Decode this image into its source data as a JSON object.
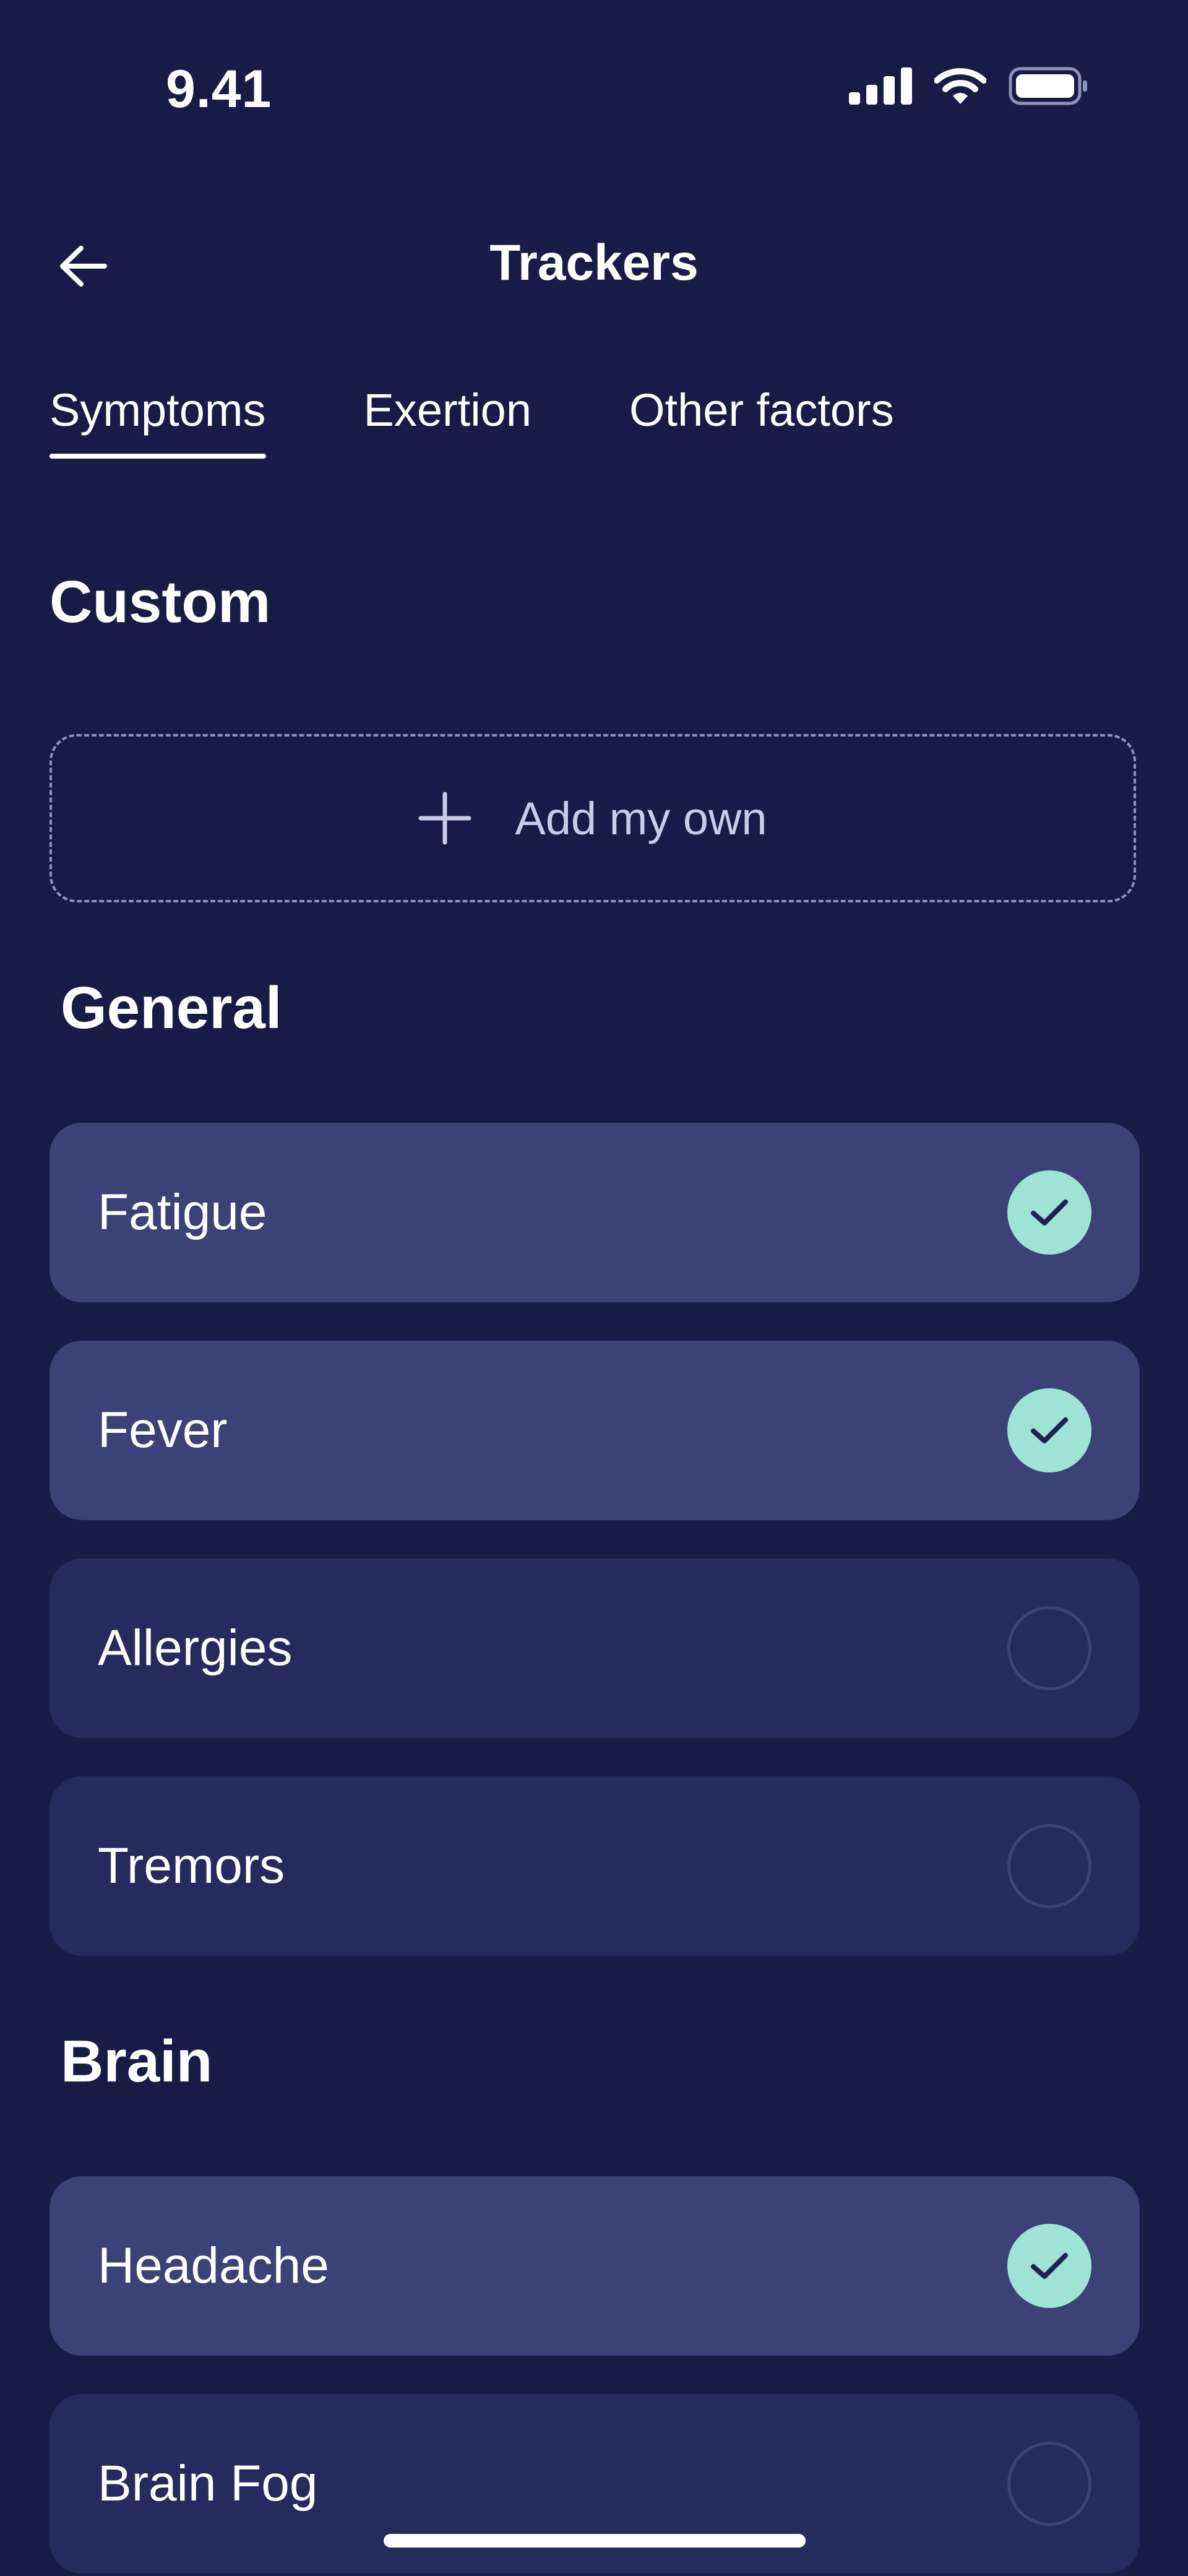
{
  "status_bar": {
    "time": "9.41",
    "icons": [
      "signal-icon",
      "wifi-icon",
      "battery-icon"
    ]
  },
  "header": {
    "title": "Trackers",
    "back_icon": "arrow-left-icon"
  },
  "tabs": [
    {
      "label": "Symptoms",
      "active": true
    },
    {
      "label": "Exertion",
      "active": false
    },
    {
      "label": "Other factors",
      "active": false
    }
  ],
  "custom": {
    "title": "Custom",
    "add_label": "Add my own",
    "add_icon": "plus-icon"
  },
  "general": {
    "title": "General",
    "items": [
      {
        "label": "Fatigue",
        "checked": true
      },
      {
        "label": "Fever",
        "checked": true
      },
      {
        "label": "Allergies",
        "checked": false
      },
      {
        "label": "Tremors",
        "checked": false
      }
    ]
  },
  "brain": {
    "title": "Brain",
    "items": [
      {
        "label": "Headache",
        "checked": true
      },
      {
        "label": "Brain Fog",
        "checked": false
      }
    ]
  },
  "colors": {
    "background": "#181b45",
    "item_checked": "#3c4176",
    "item_unchecked": "#262a5c",
    "accent_check": "#9fe3d6",
    "text": "#ffffff"
  }
}
